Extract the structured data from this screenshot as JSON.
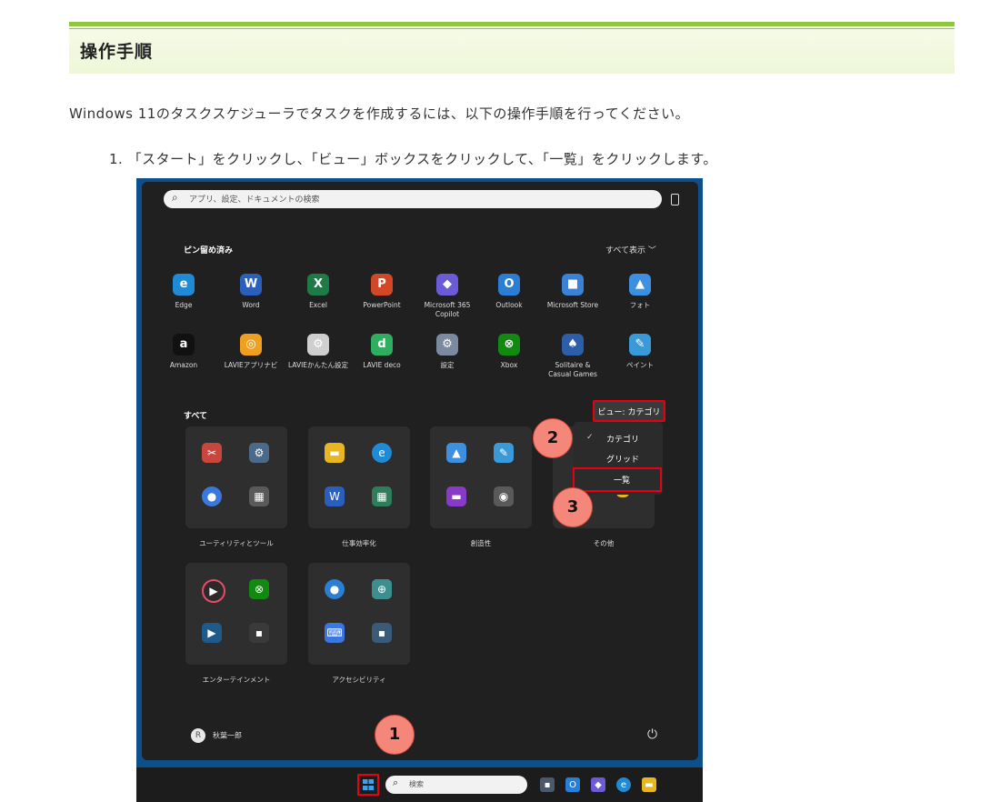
{
  "section_title": "操作手順",
  "intro": "Windows 11のタスクスケジューラでタスクを作成するには、以下の操作手順を行ってください。",
  "step1": "1. 「スタート」をクリックし、「ビュー」ボックスをクリックして、「一覧」をクリックします。",
  "screenshot": {
    "search_placeholder": "アプリ、設定、ドキュメントの検索",
    "pinned_title": "ピン留め済み",
    "show_all": "すべて表示 ﹀",
    "pinned_apps": [
      {
        "label": "Edge",
        "icon": "edge-icon",
        "glyph": "e",
        "color": "#1f8ad6"
      },
      {
        "label": "Word",
        "icon": "word-icon",
        "glyph": "W",
        "color": "#2b5fbd"
      },
      {
        "label": "Excel",
        "icon": "excel-icon",
        "glyph": "X",
        "color": "#1e7b45"
      },
      {
        "label": "PowerPoint",
        "icon": "powerpoint-icon",
        "glyph": "P",
        "color": "#d24726"
      },
      {
        "label": "Microsoft 365\nCopilot",
        "icon": "m365-copilot-icon",
        "glyph": "◆",
        "color": "#6b5bd6"
      },
      {
        "label": "Outlook",
        "icon": "outlook-icon",
        "glyph": "O",
        "color": "#2a7fd4"
      },
      {
        "label": "Microsoft Store",
        "icon": "store-icon",
        "glyph": "■",
        "color": "#3b82d6"
      },
      {
        "label": "フォト",
        "icon": "photos-icon",
        "glyph": "▲",
        "color": "#3d8fe0"
      },
      {
        "label": "Amazon",
        "icon": "amazon-icon",
        "glyph": "a",
        "color": "#111111"
      },
      {
        "label": "LAVIEアプリナビ",
        "icon": "lavie-appnavi-icon",
        "glyph": "◎",
        "color": "#f0a020"
      },
      {
        "label": "LAVIEかんたん設定",
        "icon": "lavie-settings-icon",
        "glyph": "⚙",
        "color": "#cfcfcf"
      },
      {
        "label": "LAVIE deco",
        "icon": "lavie-deco-icon",
        "glyph": "d",
        "color": "#2fae62"
      },
      {
        "label": "設定",
        "icon": "settings-icon",
        "glyph": "⚙",
        "color": "#7a8aa0"
      },
      {
        "label": "Xbox",
        "icon": "xbox-icon",
        "glyph": "⊗",
        "color": "#128a12"
      },
      {
        "label": "Solitaire &\nCasual Games",
        "icon": "solitaire-icon",
        "glyph": "♠",
        "color": "#2d5ea8"
      },
      {
        "label": "ペイント",
        "icon": "paint-icon",
        "glyph": "✎",
        "color": "#3a9ad9"
      }
    ],
    "all_title": "すべて",
    "view_button": "ビュー: カテゴリ ﹀",
    "dropdown": {
      "check": "✓",
      "category": "カテゴリ",
      "grid": "グリッド",
      "list": "一覧"
    },
    "folders": [
      {
        "label": "ユーティリティとツール"
      },
      {
        "label": "仕事効率化"
      },
      {
        "label": "創造性"
      },
      {
        "label": "その他"
      },
      {
        "label": "エンターテインメント"
      },
      {
        "label": "アクセシビリティ"
      }
    ],
    "callouts": [
      "1",
      "2",
      "3"
    ],
    "user_initial": "R",
    "user_name": "秋葉一郎",
    "power": "⏻",
    "taskbar_search": "検索"
  },
  "colors": {
    "accent_green": "#8ec63f",
    "highlight_red": "#e60012",
    "callout_fill": "#f5877a"
  }
}
